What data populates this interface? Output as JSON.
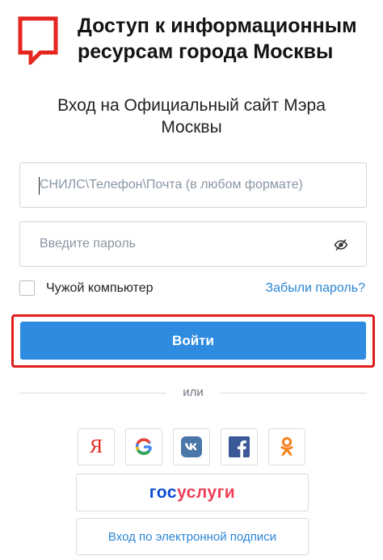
{
  "header": {
    "title_line1": "Доступ к информационным",
    "title_line2": "ресурсам города Москвы"
  },
  "subtitle_line1": "Вход на Официальный сайт Мэра",
  "subtitle_line2": "Москвы",
  "form": {
    "login_placeholder": "СНИЛС\\Телефон\\Почта (в любом формате)",
    "login_value": "",
    "password_placeholder": "Введите пароль",
    "password_value": "",
    "remember_label": "Чужой компьютер",
    "forgot_label": "Забыли пароль?",
    "submit_label": "Войти"
  },
  "divider_text": "или",
  "social": {
    "yandex_glyph": "Я",
    "icons": [
      "yandex-icon",
      "google-icon",
      "vk-icon",
      "facebook-icon",
      "odnoklassniki-icon"
    ]
  },
  "gosuslugi": {
    "part1": "гос",
    "part2": "услуги"
  },
  "esign_label": "Вход по электронной подписи",
  "colors": {
    "brand_red": "#e52620",
    "primary_blue": "#2f8be0",
    "link_blue": "#2b86d6",
    "highlight_red": "#e11c1c",
    "gos_blue": "#0d4cd3",
    "gos_red": "#ee3f58"
  }
}
